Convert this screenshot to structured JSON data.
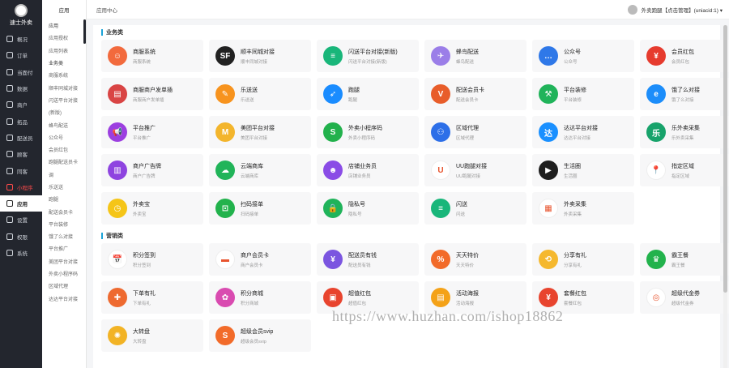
{
  "logo": {
    "text": "速士外卖"
  },
  "sidebar": {
    "items": [
      {
        "label": "概况",
        "icon": "dashboard-icon",
        "state": ""
      },
      {
        "label": "订单",
        "icon": "order-icon",
        "state": ""
      },
      {
        "label": "当面付",
        "icon": "pay-icon",
        "state": ""
      },
      {
        "label": "数据",
        "icon": "data-icon",
        "state": ""
      },
      {
        "label": "商户",
        "icon": "store-icon",
        "state": ""
      },
      {
        "label": "拓品",
        "icon": "goods-icon",
        "state": ""
      },
      {
        "label": "配送员",
        "icon": "deliver-icon",
        "state": ""
      },
      {
        "label": "顾客",
        "icon": "customer-icon",
        "state": ""
      },
      {
        "label": "同客",
        "icon": "user-icon",
        "state": ""
      },
      {
        "label": "小程序",
        "icon": "miniapp-icon",
        "state": "red"
      },
      {
        "label": "应用",
        "icon": "apps-icon",
        "state": "act"
      },
      {
        "label": "设置",
        "icon": "settings-icon",
        "state": ""
      },
      {
        "label": "权限",
        "icon": "permission-icon",
        "state": ""
      },
      {
        "label": "系统",
        "icon": "system-icon",
        "state": ""
      }
    ]
  },
  "subnav": {
    "title": "应用",
    "items": [
      {
        "label": "应用",
        "g": true
      },
      {
        "label": "应用授权",
        "g": false
      },
      {
        "label": "应用列表",
        "g": false
      },
      {
        "label": "业务类",
        "g": true
      },
      {
        "label": "商服系统",
        "g": false
      },
      {
        "label": "顺丰同城对接",
        "g": false
      },
      {
        "label": "闪送平台对接",
        "g": false
      },
      {
        "label": "(新版)",
        "g": false
      },
      {
        "label": "蜂鸟配送",
        "g": false
      },
      {
        "label": "公众号",
        "g": false
      },
      {
        "label": "会员红包",
        "g": false
      },
      {
        "label": "跑腿配送员卡",
        "g": false
      },
      {
        "label": "调",
        "g": false
      },
      {
        "label": "乐送送",
        "g": false
      },
      {
        "label": "跑腿",
        "g": false
      },
      {
        "label": "配送会员卡",
        "g": false
      },
      {
        "label": "平台装修",
        "g": false
      },
      {
        "label": "饿了么对接",
        "g": false
      },
      {
        "label": "平台推广",
        "g": false
      },
      {
        "label": "美团平台对接",
        "g": false
      },
      {
        "label": "外卖小程序码",
        "g": false
      },
      {
        "label": "区域代理",
        "g": false
      },
      {
        "label": "达达平台对接",
        "g": false
      }
    ]
  },
  "header": {
    "title": "应用中心",
    "user": "外卖跑腿【点击管理】(uniacid:1) ▾"
  },
  "sections": [
    {
      "title": "业务类",
      "apps": [
        {
          "name": "商服系统",
          "desc": "商服系统",
          "color": "#f26a3d",
          "icon": "chef-icon",
          "glyph": "☺"
        },
        {
          "name": "顺丰同城对接",
          "desc": "顺丰同城对接",
          "color": "#222222",
          "icon": "sf-express-icon",
          "glyph": "SF"
        },
        {
          "name": "闪送平台对接(新版)",
          "desc": "闪送平台对接(新版)",
          "color": "#19b67a",
          "icon": "flash-delivery-icon",
          "glyph": "≡"
        },
        {
          "name": "蜂鸟配送",
          "desc": "蜂鸟配送",
          "color": "#9b7ee8",
          "icon": "bird-icon",
          "glyph": "✈"
        },
        {
          "name": "公众号",
          "desc": "公众号",
          "color": "#2f78e8",
          "icon": "wechat-official-icon",
          "glyph": "…"
        },
        {
          "name": "会员红包",
          "desc": "会员红包",
          "color": "#e63b2e",
          "icon": "red-packet-icon",
          "glyph": "¥"
        },
        {
          "name": "商服商户发单插",
          "desc": "商服商户发单插",
          "color": "#d94444",
          "icon": "store-order-icon",
          "glyph": "▤"
        },
        {
          "name": "乐送送",
          "desc": "乐送送",
          "color": "#f7931e",
          "icon": "clipboard-icon",
          "glyph": "✎"
        },
        {
          "name": "跑腿",
          "desc": "跑腿",
          "color": "#1a8cff",
          "icon": "runner-icon",
          "glyph": "➶"
        },
        {
          "name": "配送会员卡",
          "desc": "配送会员卡",
          "color": "#e85d2a",
          "icon": "vip-card-icon",
          "glyph": "V"
        },
        {
          "name": "平台装修",
          "desc": "平台装修",
          "color": "#20b35a",
          "icon": "hammer-icon",
          "glyph": "⚒"
        },
        {
          "name": "饿了么对接",
          "desc": "饿了么对接",
          "color": "#1c8dfa",
          "icon": "eleme-icon",
          "glyph": "e"
        },
        {
          "name": "平台推广",
          "desc": "平台推广",
          "color": "#9c3fe0",
          "icon": "megaphone-icon",
          "glyph": "📢"
        },
        {
          "name": "美团平台对接",
          "desc": "美团平台对接",
          "color": "#f3b52c",
          "icon": "meituan-icon",
          "glyph": "M"
        },
        {
          "name": "外卖小程序码",
          "desc": "外卖小程序码",
          "color": "#22b14c",
          "icon": "miniprogram-icon",
          "glyph": "S"
        },
        {
          "name": "区域代理",
          "desc": "区域代理",
          "color": "#2d6fe8",
          "icon": "team-icon",
          "glyph": "⚇"
        },
        {
          "name": "达达平台对接",
          "desc": "达达平台对接",
          "color": "#1a90ff",
          "icon": "dada-icon",
          "glyph": "达"
        },
        {
          "name": "乐外卖采集",
          "desc": "乐外卖采集",
          "color": "#18a36b",
          "icon": "collect-icon",
          "glyph": "乐"
        },
        {
          "name": "商户广告牌",
          "desc": "商户广告牌",
          "color": "#8e44e0",
          "icon": "billboard-icon",
          "glyph": "▥"
        },
        {
          "name": "云端商库",
          "desc": "云端商库",
          "color": "#21b459",
          "icon": "cloud-icon",
          "glyph": "☁"
        },
        {
          "name": "店铺业务员",
          "desc": "店铺业务员",
          "color": "#8a4ce6",
          "icon": "person-icon",
          "glyph": "☻"
        },
        {
          "name": "UU跑腿对接",
          "desc": "UU跑腿对接",
          "color": "#ffffff",
          "icon": "magnet-icon",
          "glyph": "U"
        },
        {
          "name": "生活圈",
          "desc": "生活圈",
          "color": "#1e1e1e",
          "icon": "play-icon",
          "glyph": "▶"
        },
        {
          "name": "指定区域",
          "desc": "指定区域",
          "color": "#ffffff",
          "icon": "location-pin-icon",
          "glyph": "📍"
        },
        {
          "name": "外卖宝",
          "desc": "外卖宝",
          "color": "#f5c518",
          "icon": "clock-icon",
          "glyph": "◷"
        },
        {
          "name": "扫码接单",
          "desc": "扫码接单",
          "color": "#22b24c",
          "icon": "scan-icon",
          "glyph": "⊡"
        },
        {
          "name": "隐私号",
          "desc": "隐私号",
          "color": "#20b35a",
          "icon": "lock-icon",
          "glyph": "🔒"
        },
        {
          "name": "闪送",
          "desc": "闪送",
          "color": "#19b67a",
          "icon": "flash-icon",
          "glyph": "≡"
        },
        {
          "name": "外卖采集",
          "desc": "外卖采集",
          "color": "#ffffff",
          "icon": "grid-apps-icon",
          "glyph": "▦"
        }
      ]
    },
    {
      "title": "营销类",
      "apps": [
        {
          "name": "积分签到",
          "desc": "积分签到",
          "color": "#ffffff",
          "icon": "calendar-icon",
          "glyph": "📅"
        },
        {
          "name": "商户会员卡",
          "desc": "商户会员卡",
          "color": "#ffffff",
          "icon": "member-card-icon",
          "glyph": "▬"
        },
        {
          "name": "配送员有钱",
          "desc": "配送员有钱",
          "color": "#7b55e0",
          "icon": "rider-money-icon",
          "glyph": "¥"
        },
        {
          "name": "天天特价",
          "desc": "天天特价",
          "color": "#f26b2a",
          "icon": "tag-icon",
          "glyph": "%"
        },
        {
          "name": "分享有礼",
          "desc": "分享有礼",
          "color": "#f5b82e",
          "icon": "share-icon",
          "glyph": "⟲"
        },
        {
          "name": "霸王餐",
          "desc": "霸王餐",
          "color": "#22b24c",
          "icon": "crown-icon",
          "glyph": "♛"
        },
        {
          "name": "下单有礼",
          "desc": "下单有礼",
          "color": "#ee6a30",
          "icon": "gift-icon",
          "glyph": "✚"
        },
        {
          "name": "积分商城",
          "desc": "积分商城",
          "color": "#d94bb0",
          "icon": "shop-gift-icon",
          "glyph": "✿"
        },
        {
          "name": "超值红包",
          "desc": "超值红包",
          "color": "#e8442e",
          "icon": "coupon-icon",
          "glyph": "▣"
        },
        {
          "name": "活动海报",
          "desc": "活动海报",
          "color": "#f4a218",
          "icon": "poster-icon",
          "glyph": "▤"
        },
        {
          "name": "套餐红包",
          "desc": "套餐红包",
          "color": "#e8442e",
          "icon": "package-icon",
          "glyph": "¥"
        },
        {
          "name": "超级代金券",
          "desc": "超级代金券",
          "color": "#ffffff",
          "icon": "voucher-icon",
          "glyph": "◎"
        },
        {
          "name": "大转盘",
          "desc": "大转盘",
          "color": "#f2b325",
          "icon": "wheel-icon",
          "glyph": "✺"
        },
        {
          "name": "超级会员svip",
          "desc": "超级会员svip",
          "color": "#f26b2a",
          "icon": "svip-icon",
          "glyph": "S"
        }
      ]
    }
  ],
  "watermark": "https://www.huzhan.com/ishop18862"
}
